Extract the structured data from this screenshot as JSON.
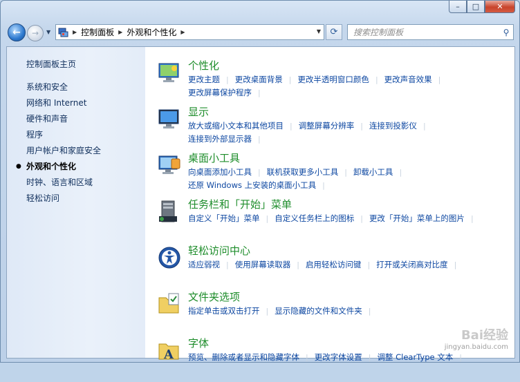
{
  "titlebar": {
    "minimize": "–",
    "maximize": "□",
    "close": "✕"
  },
  "navigation": {
    "back_glyph": "←",
    "forward_glyph": "→",
    "history_glyph": "▼",
    "breadcrumb": [
      "控制面板",
      "外观和个性化"
    ],
    "separator": "▶",
    "dropdown_glyph": "▼",
    "refresh_glyph": "⟳",
    "search_placeholder": "搜索控制面板",
    "search_glyph": "⚲"
  },
  "sidebar": {
    "home": "控制面板主页",
    "items": [
      {
        "label": "系统和安全",
        "active": false
      },
      {
        "label": "网络和 Internet",
        "active": false
      },
      {
        "label": "硬件和声音",
        "active": false
      },
      {
        "label": "程序",
        "active": false
      },
      {
        "label": "用户帐户和家庭安全",
        "active": false
      },
      {
        "label": "外观和个性化",
        "active": true
      },
      {
        "label": "时钟、语言和区域",
        "active": false
      },
      {
        "label": "轻松访问",
        "active": false
      }
    ],
    "bullet": "●"
  },
  "categories": [
    {
      "title": "个性化",
      "icon": "personalization-icon",
      "lines": [
        [
          "更改主题",
          "更改桌面背景",
          "更改半透明窗口颜色",
          "更改声音效果"
        ],
        [
          "更改屏幕保护程序"
        ]
      ]
    },
    {
      "title": "显示",
      "icon": "display-icon",
      "lines": [
        [
          "放大或缩小文本和其他项目",
          "调整屏幕分辨率",
          "连接到投影仪"
        ],
        [
          "连接到外部显示器"
        ]
      ]
    },
    {
      "title": "桌面小工具",
      "icon": "gadgets-icon",
      "lines": [
        [
          "向桌面添加小工具",
          "联机获取更多小工具",
          "卸载小工具"
        ],
        [
          "还原 Windows 上安装的桌面小工具"
        ]
      ]
    },
    {
      "title": "任务栏和「开始」菜单",
      "icon": "taskbar-icon",
      "lines": [
        [
          "自定义「开始」菜单",
          "自定义任务栏上的图标",
          "更改「开始」菜单上的图片"
        ]
      ]
    },
    {
      "title": "轻松访问中心",
      "icon": "ease-of-access-icon",
      "lines": [
        [
          "适应弱视",
          "使用屏幕读取器",
          "启用轻松访问键",
          "打开或关闭高对比度"
        ]
      ]
    },
    {
      "title": "文件夹选项",
      "icon": "folder-options-icon",
      "lines": [
        [
          "指定单击或双击打开",
          "显示隐藏的文件和文件夹"
        ]
      ]
    },
    {
      "title": "字体",
      "icon": "fonts-icon",
      "lines": [
        [
          "预览、删除或者显示和隐藏字体",
          "更改字体设置",
          "调整 ClearType 文本"
        ]
      ]
    }
  ],
  "watermark": {
    "main": "Bai经验",
    "sub": "jingyan.baidu.com"
  },
  "colors": {
    "title_green": "#1e8d2b",
    "link_blue": "#0d47a1"
  }
}
